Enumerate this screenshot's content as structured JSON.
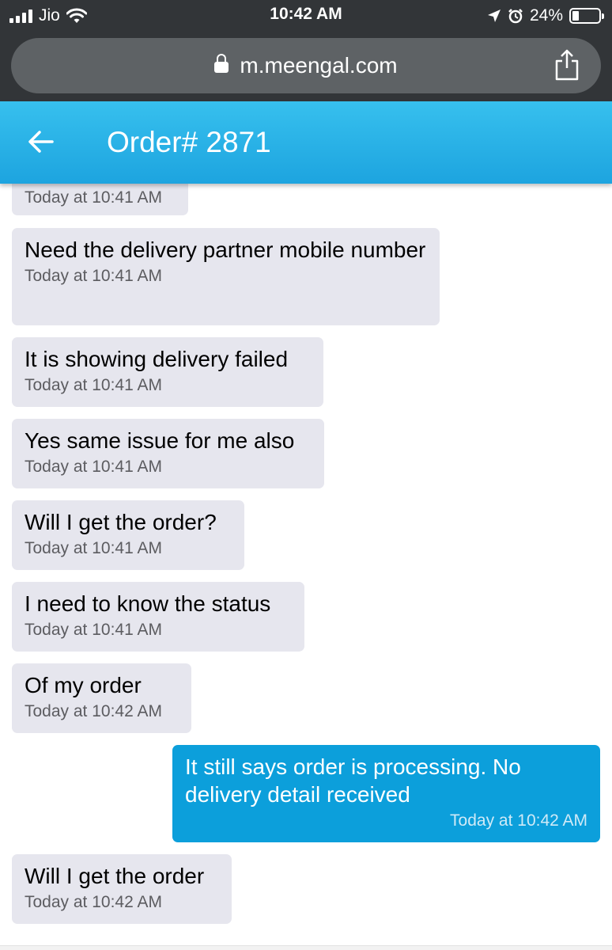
{
  "status_bar": {
    "carrier": "Jio",
    "time": "10:42 AM",
    "battery_percent": "24%",
    "battery_level": 0.24,
    "icons": [
      "signal-icon",
      "wifi-icon",
      "location-icon",
      "alarm-icon",
      "battery-icon"
    ]
  },
  "browser": {
    "url": "m.meengal.com",
    "icons": [
      "lock-icon",
      "share-icon"
    ]
  },
  "header": {
    "title": "Order# 2871",
    "back_icon": "back-arrow-icon",
    "colors": {
      "top": "#37c0ee",
      "bottom": "#1da4df"
    }
  },
  "messages": [
    {
      "direction": "in",
      "text": "",
      "time": "Today at 10:41 AM"
    },
    {
      "direction": "in",
      "text": "Need the delivery partner mobile number",
      "time": "Today at 10:41 AM"
    },
    {
      "direction": "in",
      "text": "It is showing delivery failed",
      "time": "Today at 10:41 AM"
    },
    {
      "direction": "in",
      "text": "Yes same issue for me also",
      "time": "Today at 10:41 AM"
    },
    {
      "direction": "in",
      "text": "Will I get the order?",
      "time": "Today at 10:41 AM"
    },
    {
      "direction": "in",
      "text": "I need to know the status",
      "time": "Today at 10:41 AM"
    },
    {
      "direction": "in",
      "text": "Of my order",
      "time": "Today at 10:42 AM"
    },
    {
      "direction": "out",
      "text": "It still says order is processing. No delivery detail received",
      "time": "Today at 10:42 AM"
    },
    {
      "direction": "in",
      "text": "Will I get the order",
      "time": "Today at 10:42 AM"
    }
  ],
  "colors": {
    "incoming_bubble": "#e6e6ee",
    "outgoing_bubble": "#0c9fdb"
  }
}
